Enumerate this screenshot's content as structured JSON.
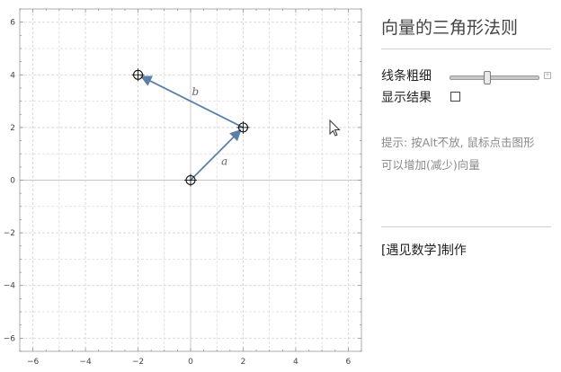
{
  "panel": {
    "title": "向量的三角形法则",
    "line_width_label": "线条粗细",
    "line_width_value": 0.4,
    "show_result_label": "显示结果",
    "show_result_checked": false,
    "hint_line1": "提示: 按Alt不放, 鼠标点击图形",
    "hint_line2": "可以增加(减少)向量",
    "credit": "[遇见数学]制作"
  },
  "plot": {
    "x_range": [
      -6.5,
      6.5
    ],
    "y_range": [
      -6.5,
      6.5
    ],
    "x_ticks": [
      -6,
      -4,
      -2,
      0,
      2,
      4,
      6
    ],
    "y_ticks": [
      6,
      4,
      2,
      0,
      -2,
      -4,
      -6
    ],
    "vector_color": "#5b7fa6",
    "points": [
      {
        "x": 0,
        "y": 0
      },
      {
        "x": 2,
        "y": 2
      },
      {
        "x": -2,
        "y": 4
      }
    ],
    "vectors": [
      {
        "label": "a",
        "from": [
          0,
          0
        ],
        "to": [
          2,
          2
        ]
      },
      {
        "label": "b",
        "from": [
          2,
          2
        ],
        "to": [
          -2,
          4
        ]
      }
    ]
  },
  "icons": {
    "cursor": "mouse-pointer-icon",
    "slider_expand": "plus-icon"
  }
}
